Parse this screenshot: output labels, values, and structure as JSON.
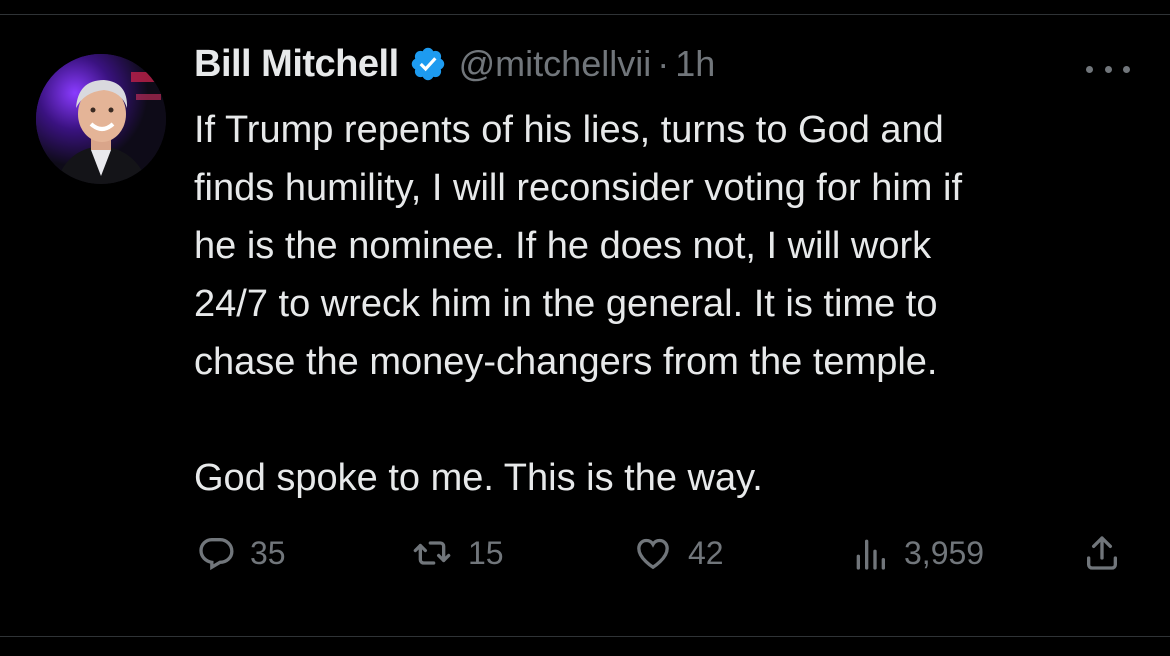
{
  "tweet": {
    "author": {
      "display_name": "Bill Mitchell",
      "handle": "@mitchellvii",
      "verified": true
    },
    "separator": "·",
    "time_ago": "1h",
    "text_lines": [
      "If Trump repents of his lies, turns to God and",
      "finds humility, I will reconsider voting for him if",
      "he is the nominee.  If he does not, I will work",
      "24/7 to wreck him in the general. It is time to",
      "chase the money-changers from the temple.",
      "",
      "God spoke to me. This is the way."
    ],
    "stats": {
      "replies": "35",
      "retweets": "15",
      "likes": "42",
      "views": "3,959"
    },
    "icons": {
      "more": "more-horizontal-icon",
      "reply": "reply-icon",
      "retweet": "retweet-icon",
      "like": "heart-icon",
      "views": "views-icon",
      "share": "share-icon"
    },
    "colors": {
      "background": "#000000",
      "text": "#e7e9ea",
      "secondary": "#71767b",
      "verified": "#1d9bf0",
      "divider": "#2f3336"
    }
  }
}
